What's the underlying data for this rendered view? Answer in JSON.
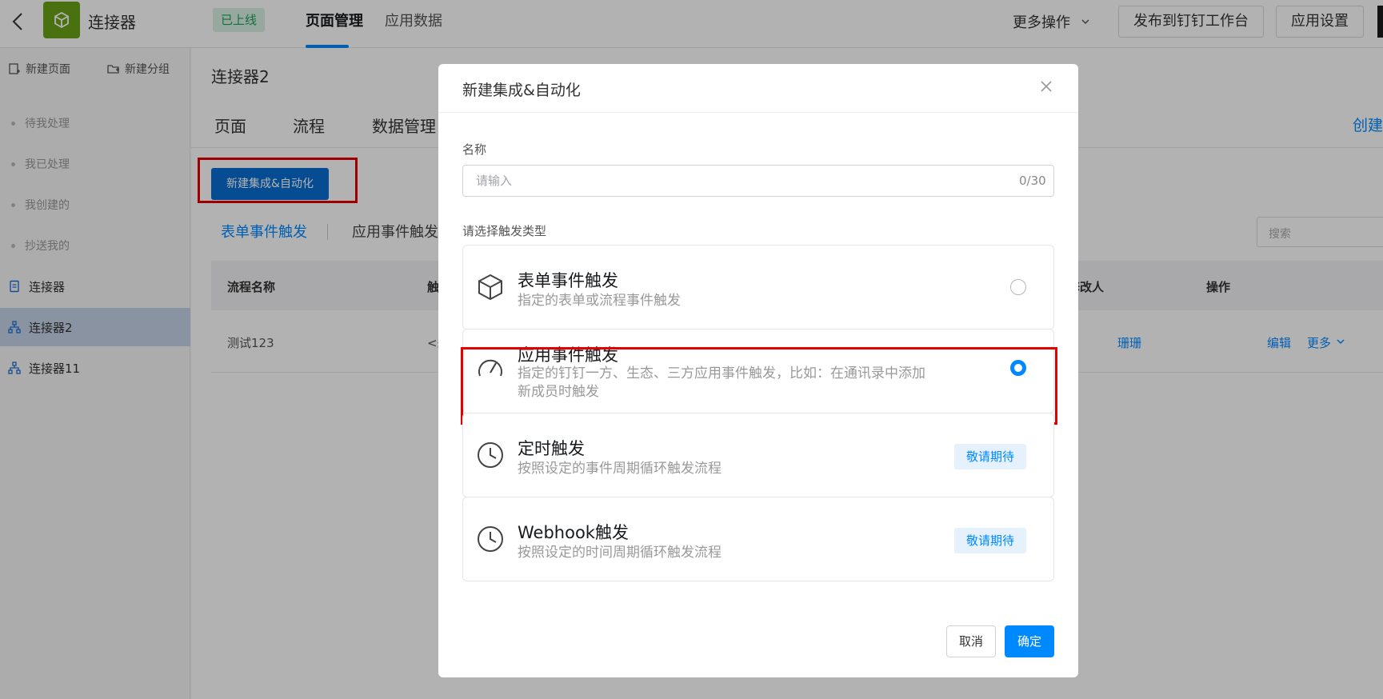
{
  "topbar": {
    "app_name": "连接器",
    "status_badge": "已上线",
    "tabs": [
      {
        "label": "页面管理",
        "active": true
      },
      {
        "label": "应用数据",
        "active": false
      }
    ],
    "more_ops": "更多操作",
    "publish_button": "发布到钉钉工作台",
    "settings_button": "应用设置"
  },
  "sidebar": {
    "new_page": "新建页面",
    "new_group": "新建分组",
    "sub_items": [
      "待我处理",
      "我已处理",
      "我创建的",
      "抄送我的"
    ],
    "items": [
      {
        "label": "连接器",
        "icon": "document-icon",
        "active": false
      },
      {
        "label": "连接器2",
        "icon": "flow-icon",
        "active": true
      },
      {
        "label": "连接器11",
        "icon": "flow-icon",
        "active": false
      }
    ]
  },
  "main": {
    "title": "连接器2",
    "tabs": [
      "页面",
      "流程",
      "数据管理"
    ],
    "create_link": "创建",
    "new_button": "新建集成&自动化",
    "trigger_tabs": [
      "表单事件触发",
      "应用事件触发"
    ],
    "search_placeholder": "搜索",
    "table": {
      "headers": [
        "流程名称",
        "触",
        "修改人",
        "操作"
      ],
      "rows": [
        {
          "name": "测试123",
          "trigger": "<未",
          "modifier": "珊珊",
          "edit": "编辑",
          "more": "更多"
        }
      ]
    }
  },
  "modal": {
    "title": "新建集成&自动化",
    "name_label": "名称",
    "name_placeholder": "请输入",
    "name_counter": "0/30",
    "type_label": "请选择触发类型",
    "options": [
      {
        "title": "表单事件触发",
        "desc": "指定的表单或流程事件触发",
        "icon": "cube-icon",
        "state": "unchecked"
      },
      {
        "title": "应用事件触发",
        "desc": "指定的钉钉一方、生态、三方应用事件触发，比如：在通讯录中添加新成员时触发",
        "icon": "gauge-icon",
        "state": "checked"
      },
      {
        "title": "定时触发",
        "desc": "按照设定的事件周期循环触发流程",
        "icon": "clock-icon",
        "state": "coming",
        "badge": "敬请期待"
      },
      {
        "title": "Webhook触发",
        "desc": "按照设定的时间周期循环触发流程",
        "icon": "clock-icon",
        "state": "coming",
        "badge": "敬请期待"
      }
    ],
    "cancel": "取消",
    "confirm": "确定"
  },
  "colors": {
    "accent": "#0089ff",
    "highlight": "#e30000",
    "app_logo": "#6aa318"
  }
}
